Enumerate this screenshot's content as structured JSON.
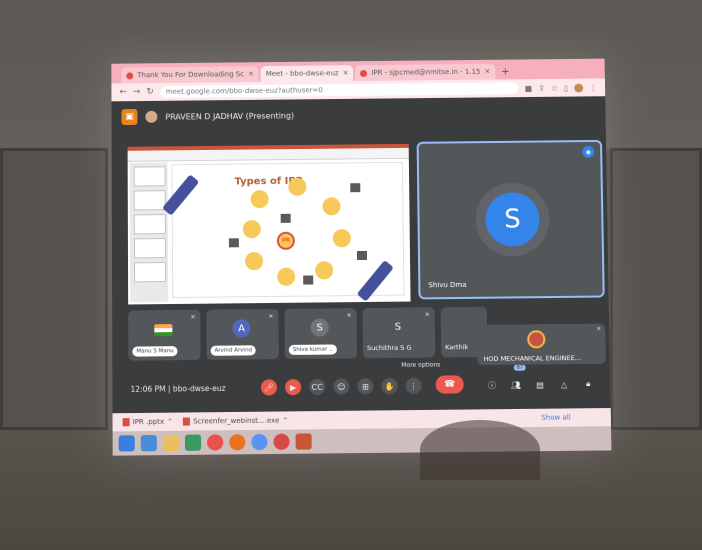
{
  "browser": {
    "tabs": [
      {
        "label": "Thank You For Downloading Sc",
        "active": false
      },
      {
        "label": "Meet - bbo-dwse-euz",
        "active": true
      },
      {
        "label": "IPR - sjpcmed@nmitse.in - 1.15",
        "active": false
      }
    ],
    "new_tab_symbol": "+",
    "url": "meet.google.com/bbo-dwse-euz?authuser=0"
  },
  "meet": {
    "presenting_label": "PRAVEEN D JADHAV (Presenting)",
    "slide": {
      "title": "Types of IPR",
      "center_label": "IPR"
    },
    "main_tile": {
      "avatar_letter": "S",
      "name": "Shivu Dma"
    },
    "participants": [
      {
        "name": "Manu S Manu",
        "avatar": "flag",
        "avatar_color": "#ff9933"
      },
      {
        "name": "Arvind Arvind",
        "avatar": "A",
        "avatar_color": "#3f51b5"
      },
      {
        "name": "Shiva kumar ..",
        "avatar": "S",
        "avatar_color": "#5f6368"
      },
      {
        "name": "Suchithra S G",
        "avatar": "S",
        "avatar_color": "#3c4043"
      },
      {
        "name": "Karthik",
        "avatar": "",
        "avatar_color": "#3c4043"
      }
    ],
    "hod_tile": {
      "name": "HOD MECHANICAL ENGINEE..."
    },
    "more_options_tooltip": "More options",
    "time_meeting": "12:06 PM  |  bbo-dwse-euz",
    "participant_count": "87",
    "colors": {
      "accent": "#1a73e8",
      "end_call": "#ea4335",
      "bg": "#202124"
    }
  },
  "downloads": [
    {
      "name": "IPR .pptx"
    },
    {
      "name": "Screenfer_webinst....exe"
    }
  ],
  "downloads_show_all": "Show all"
}
